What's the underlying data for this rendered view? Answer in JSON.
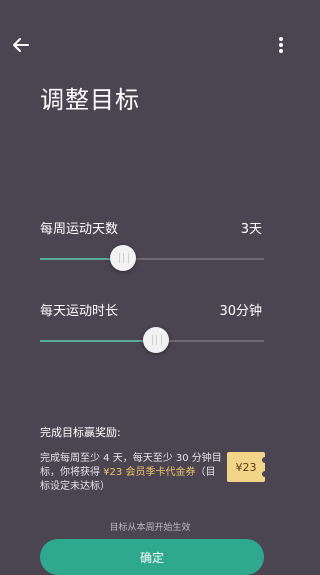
{
  "header": {
    "title": "调整目标"
  },
  "weekly": {
    "label": "每周运动天数",
    "value": "3天",
    "level": 0.37
  },
  "daily": {
    "label": "每天运动时长",
    "value": "30分钟",
    "level": 0.52
  },
  "reward": {
    "title": "完成目标赢奖励:",
    "text_prefix": "完成每周至少 4 天，每天至少 30 分钟目标，你将获得 ",
    "text_highlight": "¥23 会员季卡代金券",
    "text_suffix": "（目标设定未达标）",
    "coupon_label": "¥23"
  },
  "footer": {
    "note": "目标从本周开始生效",
    "confirm_label": "确定"
  },
  "colors": {
    "background": "#4b4552",
    "accent": "#2fa98e",
    "highlight": "#f0c36a",
    "coupon_bg": "#f3d58a"
  },
  "icons": {
    "back": "arrow-left-icon",
    "menu": "more-vertical-icon"
  }
}
